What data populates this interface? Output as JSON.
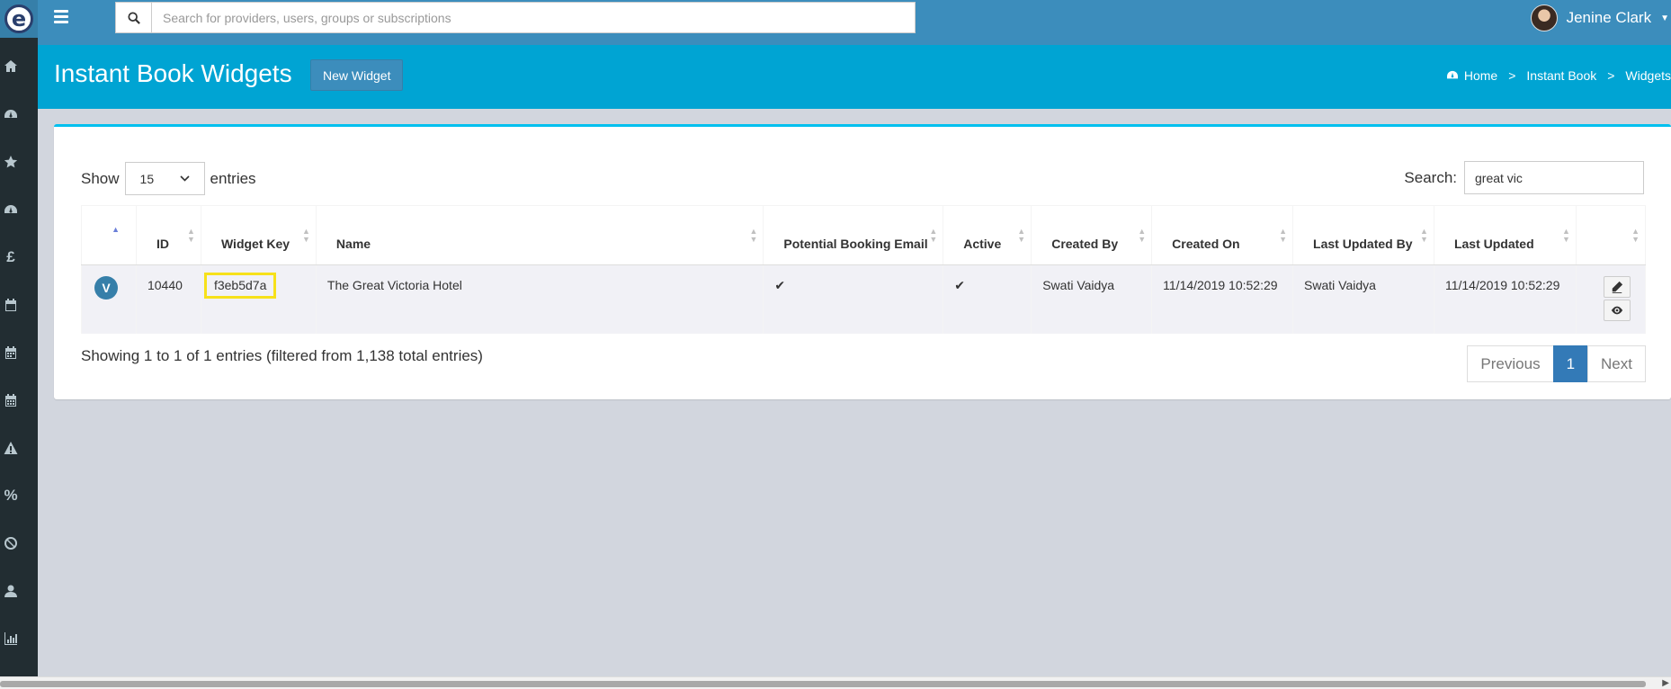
{
  "nav": {
    "search_placeholder": "Search for providers, users, groups or subscriptions",
    "user_name": "Jenine Clark"
  },
  "header": {
    "title": "Instant Book Widgets",
    "new_widget_label": "New Widget",
    "breadcrumb": [
      "Home",
      "Instant Book",
      "Widgets"
    ]
  },
  "sidebar": {
    "icons": [
      "home-icon",
      "dashboard-icon",
      "star-icon",
      "dashboard-icon",
      "pound-icon",
      "calendar-icon",
      "calendar-icon",
      "calendar-icon",
      "warning-icon",
      "percent-icon",
      "ban-icon",
      "user-icon",
      "bar-chart-icon"
    ]
  },
  "table_controls": {
    "show_label": "Show",
    "entries_label": "entries",
    "page_length": "15",
    "search_label": "Search:",
    "search_value": "great vic"
  },
  "table": {
    "columns": [
      "ID",
      "Widget Key",
      "Name",
      "Potential Booking Email",
      "Active",
      "Created By",
      "Created On",
      "Last Updated By",
      "Last Updated"
    ],
    "rows": [
      {
        "badge": "V",
        "id": "10440",
        "widget_key": "f3eb5d7a",
        "name": "The Great Victoria Hotel",
        "potential_booking_email": "✔",
        "active": "✔",
        "created_by": "Swati Vaidya",
        "created_on": "11/14/2019 10:52:29",
        "last_updated_by": "Swati Vaidya",
        "last_updated": "11/14/2019 10:52:29"
      }
    ]
  },
  "footer": {
    "info": "Showing 1 to 1 of 1 entries (filtered from 1,138 total entries)",
    "previous_label": "Previous",
    "current_page": "1",
    "next_label": "Next"
  },
  "colors": {
    "nav_blue": "#3c8dbc",
    "header_cyan": "#00a4d3",
    "sidebar_dark": "#222d32",
    "highlight_yellow": "#f7e11a"
  }
}
